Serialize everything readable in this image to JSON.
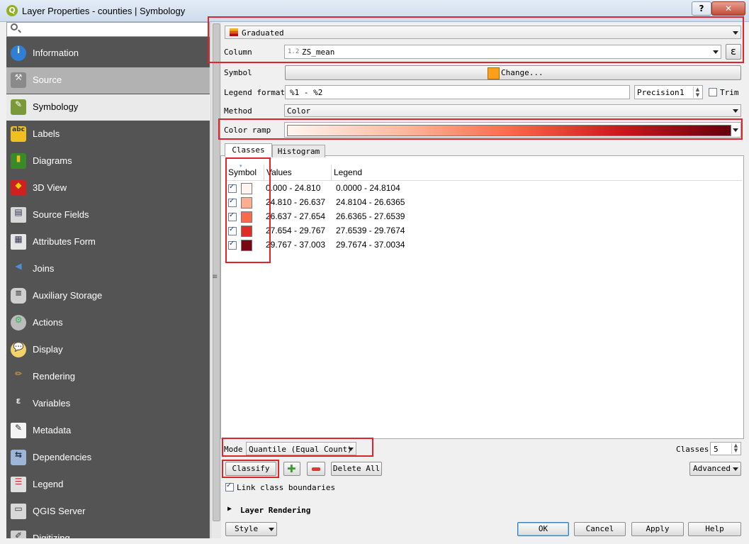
{
  "window": {
    "title": "Layer Properties - counties | Symbology",
    "help_label": "?",
    "close_label": "✕"
  },
  "sidebar": {
    "search": {
      "value": "",
      "placeholder": ""
    },
    "items": [
      {
        "label": "Information",
        "icon": "info-icon"
      },
      {
        "label": "Source",
        "icon": "source-icon"
      },
      {
        "label": "Symbology",
        "icon": "symbology-icon"
      },
      {
        "label": "Labels",
        "icon": "labels-icon"
      },
      {
        "label": "Diagrams",
        "icon": "diagrams-icon"
      },
      {
        "label": "3D View",
        "icon": "3d-view-icon"
      },
      {
        "label": "Source Fields",
        "icon": "source-fields-icon"
      },
      {
        "label": "Attributes Form",
        "icon": "attributes-form-icon"
      },
      {
        "label": "Joins",
        "icon": "joins-icon"
      },
      {
        "label": "Auxiliary Storage",
        "icon": "auxiliary-storage-icon"
      },
      {
        "label": "Actions",
        "icon": "actions-icon"
      },
      {
        "label": "Display",
        "icon": "display-icon"
      },
      {
        "label": "Rendering",
        "icon": "rendering-icon"
      },
      {
        "label": "Variables",
        "icon": "variables-icon"
      },
      {
        "label": "Metadata",
        "icon": "metadata-icon"
      },
      {
        "label": "Dependencies",
        "icon": "dependencies-icon"
      },
      {
        "label": "Legend",
        "icon": "legend-icon"
      },
      {
        "label": "QGIS Server",
        "icon": "qgis-server-icon"
      },
      {
        "label": "Digitizing",
        "icon": "digitizing-icon"
      }
    ]
  },
  "renderer": {
    "selected": "Graduated"
  },
  "column": {
    "label": "Column",
    "type_badge": "1.2",
    "value": "ZS_mean",
    "expr_label": "ε"
  },
  "symbol": {
    "label": "Symbol",
    "change_label": "Change...",
    "color": "#ff9e17"
  },
  "legend_format": {
    "label": "Legend format",
    "value": "%1 - %2",
    "precision_label": "Precision",
    "precision_value": "1",
    "trim_label": "Trim"
  },
  "method": {
    "label": "Method",
    "value": "Color"
  },
  "color_ramp": {
    "label": "Color ramp",
    "stops": [
      "#fff5f0",
      "#fcbba1",
      "#fb6a4a",
      "#cb181d",
      "#67000d"
    ]
  },
  "tabs": [
    {
      "label": "Classes"
    },
    {
      "label": "Histogram"
    }
  ],
  "classes_table": {
    "headers": {
      "symbol": "Symbol",
      "values": "Values",
      "legend": "Legend"
    },
    "rows": [
      {
        "color": "#fff5f0",
        "values": "0.000 - 24.810",
        "legend": "0.0000 - 24.8104"
      },
      {
        "color": "#fcae91",
        "values": "24.810 - 26.637",
        "legend": "24.8104 - 26.6365"
      },
      {
        "color": "#fb6a4a",
        "values": "26.637 - 27.654",
        "legend": "26.6365 - 27.6539"
      },
      {
        "color": "#de2d26",
        "values": "27.654 - 29.767",
        "legend": "27.6539 - 29.7674"
      },
      {
        "color": "#7a0412",
        "values": "29.767 - 37.003",
        "legend": "29.7674 - 37.0034"
      }
    ]
  },
  "mode": {
    "label": "Mode",
    "value": "Quantile (Equal Count)"
  },
  "classes_count": {
    "label": "Classes",
    "value": "5"
  },
  "actions": {
    "classify": "Classify",
    "delete_all": "Delete All",
    "advanced": "Advanced",
    "link_boundaries": "Link class boundaries"
  },
  "layer_rendering": {
    "label": "Layer Rendering"
  },
  "footer": {
    "style": "Style",
    "ok": "OK",
    "cancel": "Cancel",
    "apply": "Apply",
    "help": "Help"
  }
}
